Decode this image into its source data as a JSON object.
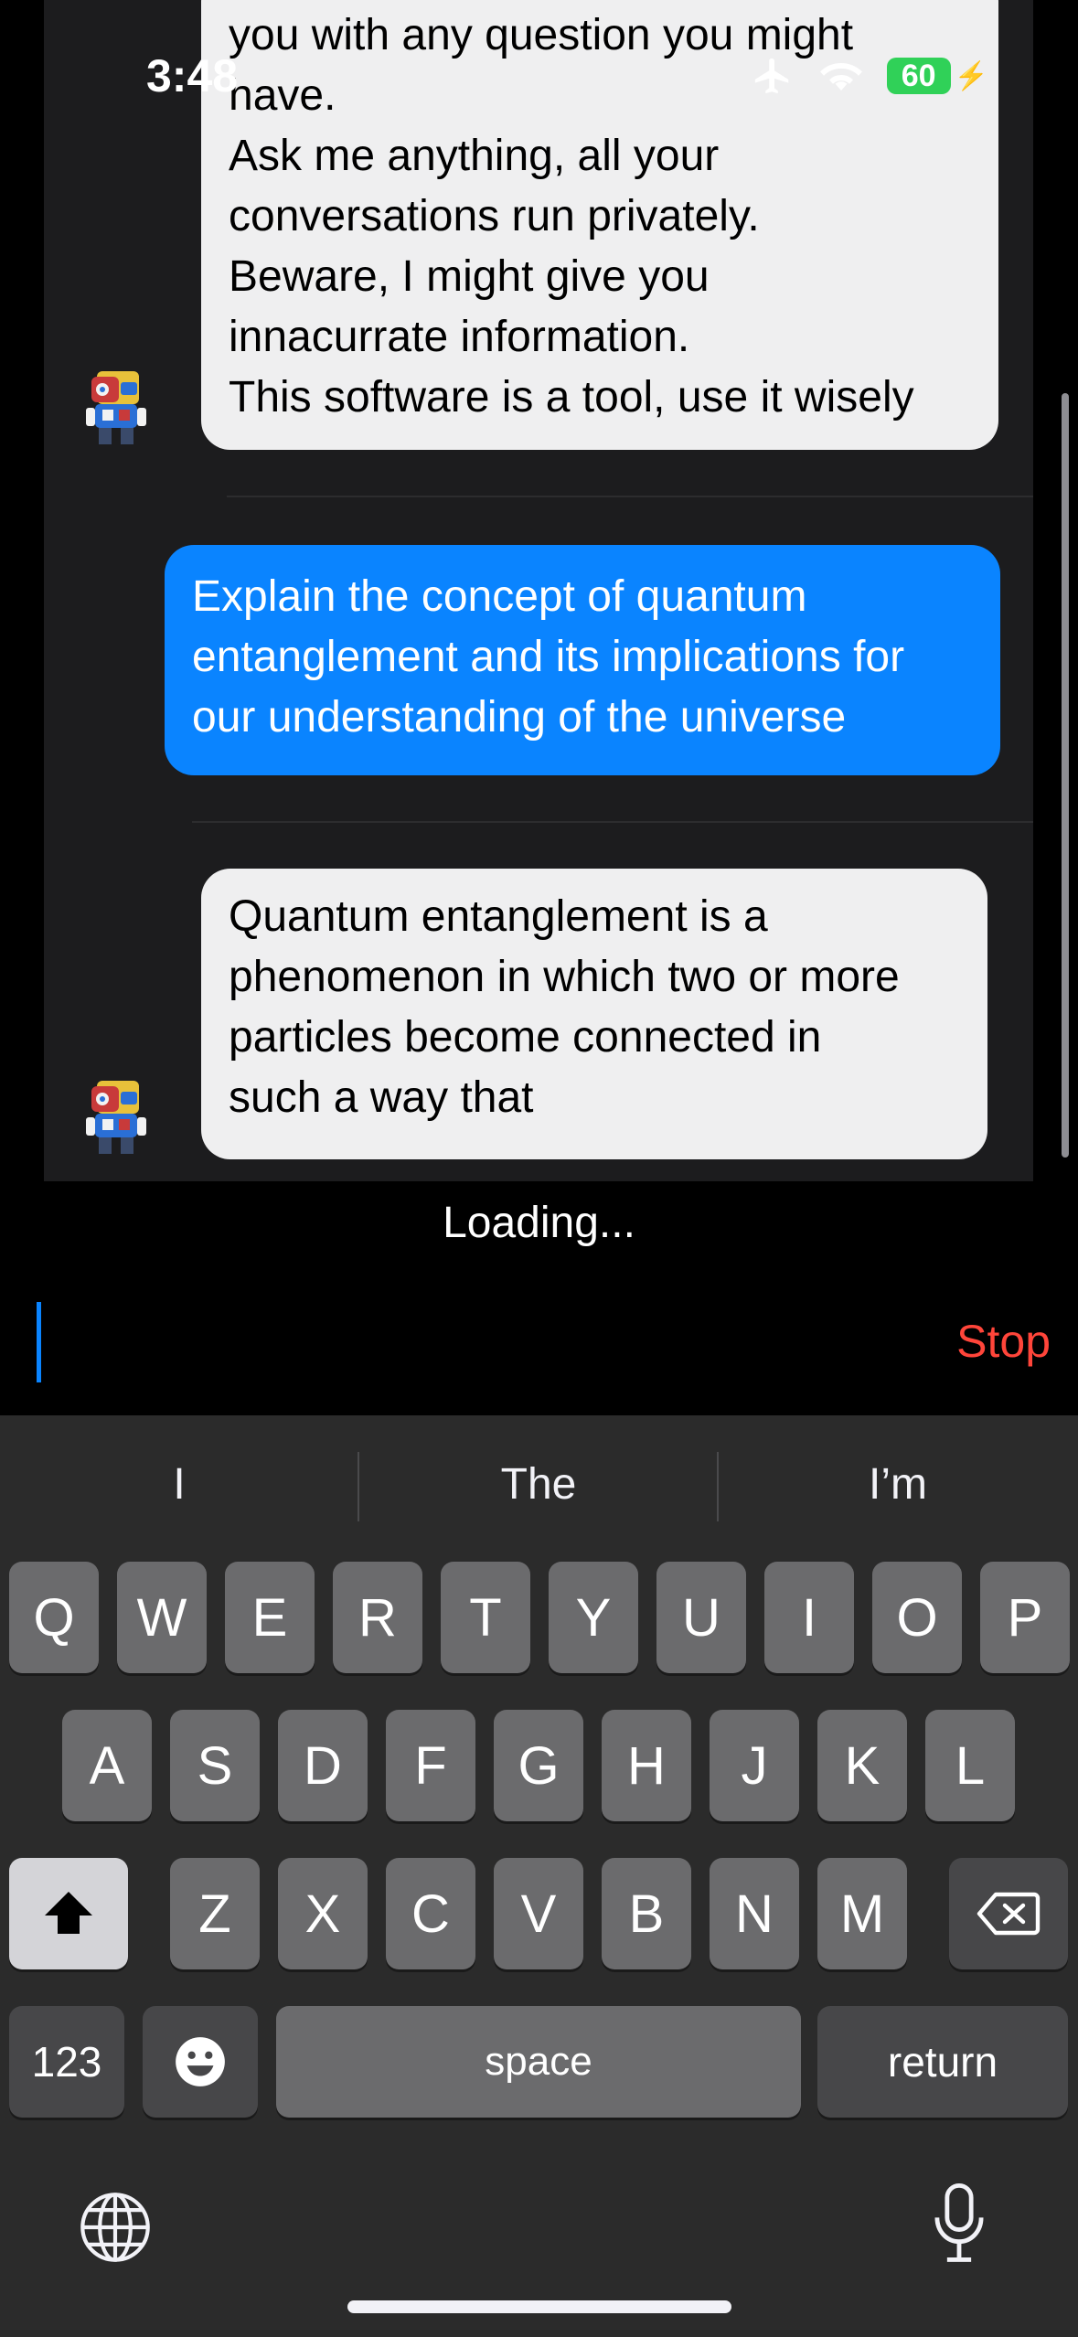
{
  "status_bar": {
    "time": "3:48",
    "battery": "60"
  },
  "chat": {
    "messages": [
      {
        "role": "bot",
        "lines": [
          "you with any question you might",
          "have.",
          "Ask me anything, all your",
          "conversations run privately.",
          "Beware, I might give you",
          "innacurrate information.",
          "This software is a tool, use it wisely"
        ]
      },
      {
        "role": "user",
        "lines": [
          "Explain the concept of quantum",
          "entanglement and its implications for",
          "our understanding of the universe"
        ]
      },
      {
        "role": "bot",
        "lines": [
          "Quantum entanglement is a",
          "phenomenon in which two or more",
          "particles become connected in",
          "such a way that"
        ]
      }
    ],
    "loading_text": "Loading..."
  },
  "input": {
    "stop_label": "Stop"
  },
  "keyboard": {
    "suggestions": [
      "I",
      "The",
      "I’m"
    ],
    "row1": [
      "Q",
      "W",
      "E",
      "R",
      "T",
      "Y",
      "U",
      "I",
      "O",
      "P"
    ],
    "row2": [
      "A",
      "S",
      "D",
      "F",
      "G",
      "H",
      "J",
      "K",
      "L"
    ],
    "row3": [
      "Z",
      "X",
      "C",
      "V",
      "B",
      "N",
      "M"
    ],
    "numbers_label": "123",
    "space_label": "space",
    "return_label": "return"
  },
  "colors": {
    "user_bubble": "#0a84ff",
    "bot_bubble": "#efeff0",
    "stop": "#ff453a",
    "battery": "#30d158"
  }
}
